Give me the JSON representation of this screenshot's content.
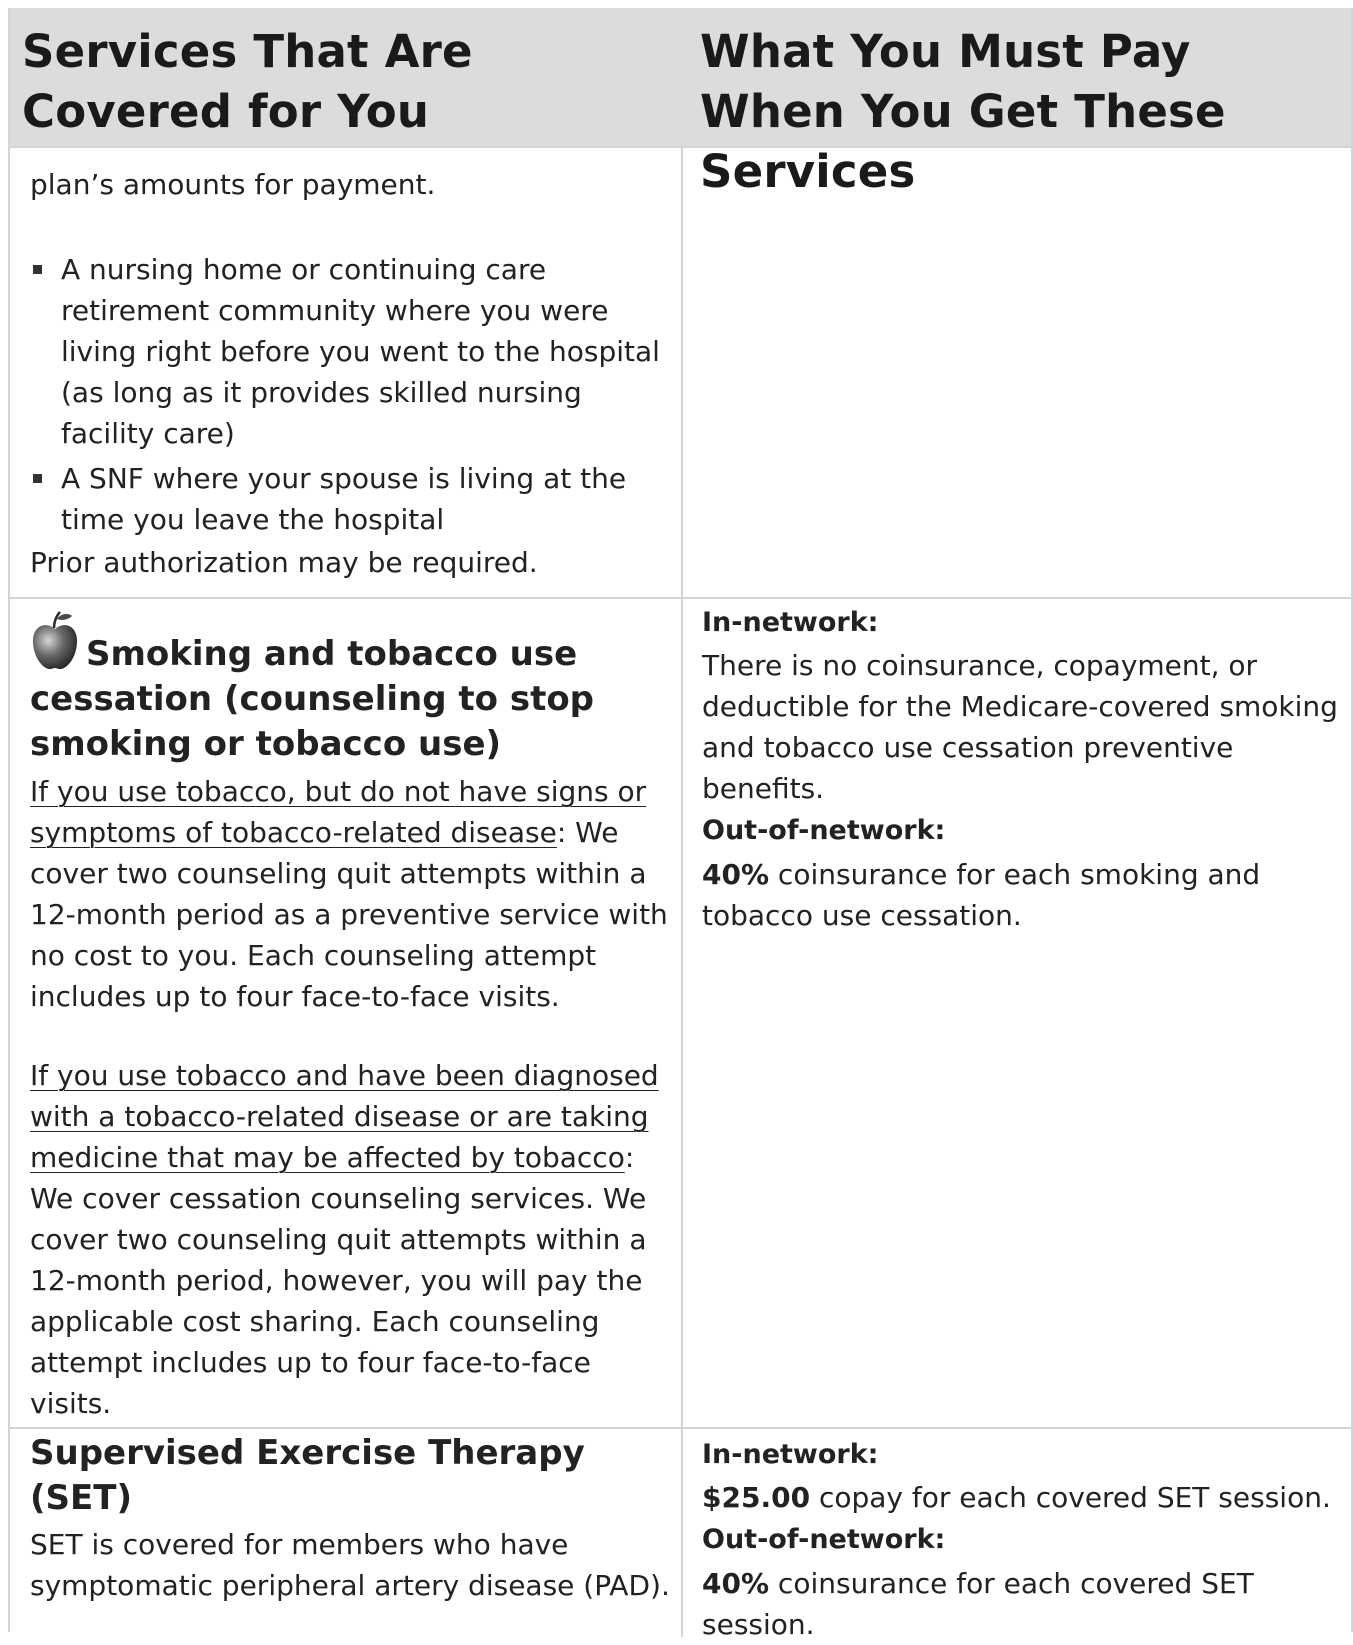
{
  "header": {
    "col1": "Services That Are Covered for You",
    "col2": "What You Must Pay When You Get These Services"
  },
  "row_snf": {
    "intro": "plan’s amounts for payment.",
    "bullets": [
      "A nursing home or continuing care retirement community where you were living right before you went to the hospital (as long as it provides skilled nursing facility care)",
      "A SNF where your spouse is living at the time you leave the hospital"
    ],
    "note": "Prior authorization may be required."
  },
  "row_smoking": {
    "icon": "apple-icon",
    "title": "Smoking and tobacco use cessation (counseling to stop smoking or tobacco use)",
    "p1_underlined": "If you use tobacco, but do not have signs or symptoms of tobacco-related disease",
    "p1_rest": ": We cover two counseling quit attempts within a 12-month period as a preventive service with no cost to you. Each counseling attempt includes up to four face-to-face visits.",
    "p2_underlined": "If you use tobacco and have been diagnosed with a tobacco-related disease or are taking medicine that may be affected by tobacco",
    "p2_rest": ": We cover cessation counseling services. We cover two counseling quit attempts within a 12-month period, however, you will pay the applicable cost sharing. Each counseling attempt includes up to four face-to-face visits.",
    "in_network_label": "In-network:",
    "in_network_text": "There is no coinsurance, copayment, or deductible for the Medicare-covered smoking and tobacco use cessation preventive benefits.",
    "out_network_label": "Out-of-network:",
    "out_network_amount": "40%",
    "out_network_text": " coinsurance for each smoking and tobacco use cessation."
  },
  "row_set": {
    "title": "Supervised Exercise Therapy (SET)",
    "desc": "SET is covered for members who have symptomatic peripheral artery disease (PAD).",
    "in_network_label": "In-network:",
    "in_network_amount": "$25.00",
    "in_network_text": " copay for each covered SET session.",
    "out_network_label": "Out-of-network:",
    "out_network_amount": "40%",
    "out_network_text": " coinsurance for each covered SET session."
  }
}
